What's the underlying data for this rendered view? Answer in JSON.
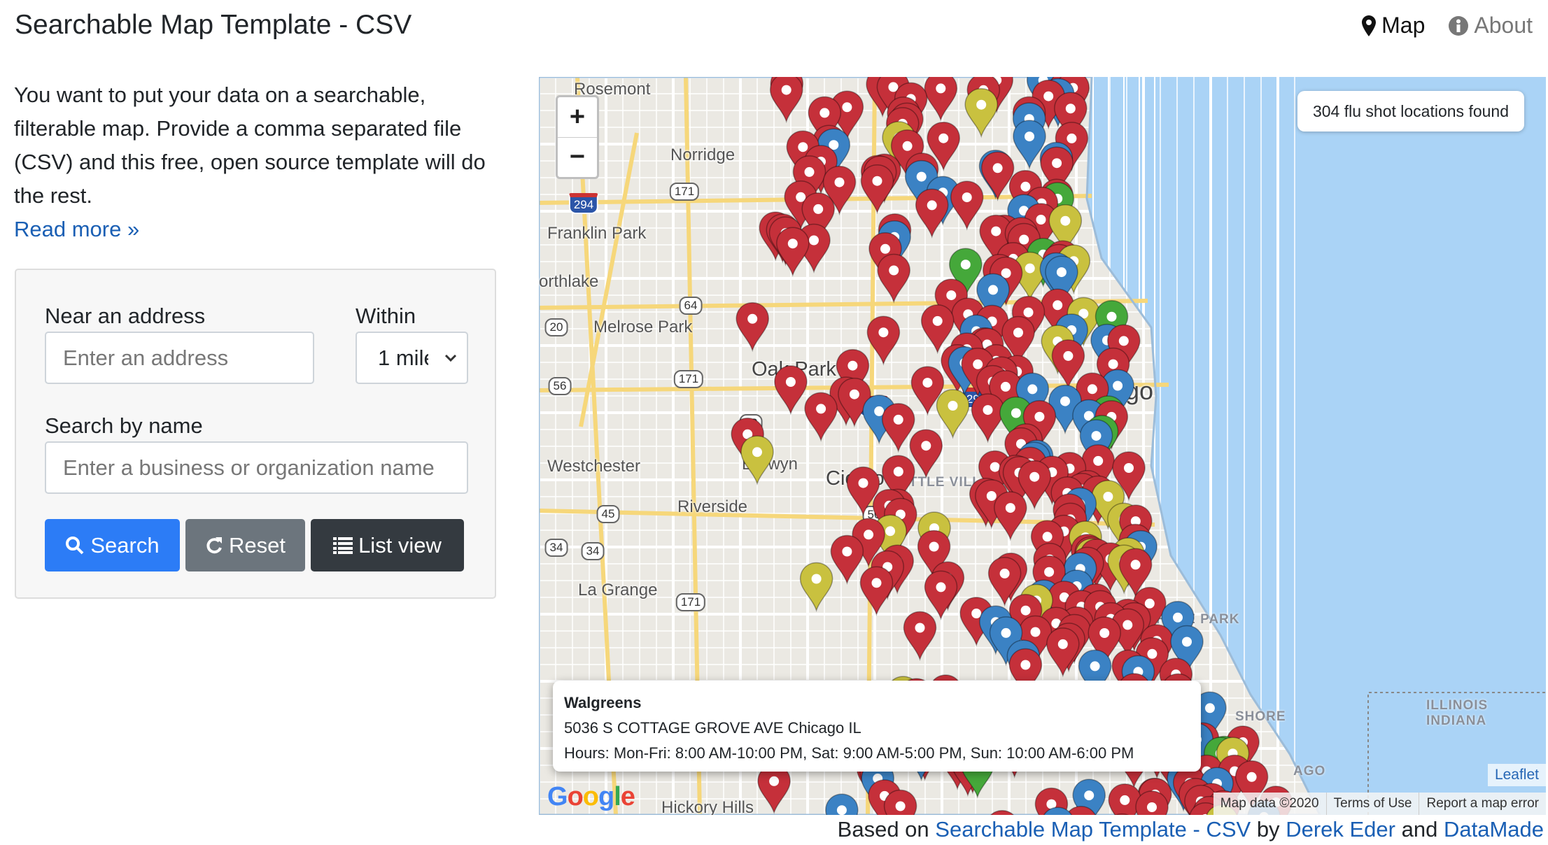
{
  "header": {
    "title": "Searchable Map Template - CSV",
    "nav": [
      {
        "label": "Map",
        "icon": "map-marker-icon"
      },
      {
        "label": "About",
        "icon": "info-circle-icon"
      }
    ]
  },
  "intro": {
    "text": "You want to put your data on a searchable, filterable map. Provide a comma separated file (CSV) and this free, open source template will do the rest.",
    "read_more": "Read more »"
  },
  "form": {
    "address_label": "Near an address",
    "address_placeholder": "Enter an address",
    "within_label": "Within",
    "within_value": "1 mile",
    "name_label": "Search by name",
    "name_placeholder": "Enter a business or organization name",
    "search_button": "Search",
    "reset_button": "Reset",
    "list_button": "List view"
  },
  "map": {
    "zoom_in": "+",
    "zoom_out": "−",
    "count_text": "304 flu shot locations found",
    "places": [
      "Rosemont",
      "Norridge",
      "Franklin Park",
      "orthlake",
      "Melrose Park",
      "Oak Park",
      "Westchester",
      "Berwyn",
      "Cicero",
      "Riverside",
      "La Grange",
      "Hickory Hills",
      "go"
    ],
    "districts": [
      "LITTLE VILL",
      "HYDE PARK",
      "SHORE",
      "AGO",
      "ILLINOIS",
      "INDIANA"
    ],
    "shields": [
      "294",
      "171",
      "64",
      "20",
      "171",
      "56",
      "43",
      "290",
      "290",
      "64",
      "45",
      "50",
      "34",
      "34",
      "171"
    ],
    "popup": {
      "name": "Walgreens",
      "address": "5036 S COTTAGE GROVE AVE Chicago IL",
      "hours": "Hours: Mon-Fri: 8:00 AM-10:00 PM, Sat: 9:00 AM-5:00 PM, Sun: 10:00 AM-6:00 PM"
    },
    "leaflet": "Leaflet",
    "attribution": [
      "Map data ©2020",
      "Terms of Use",
      "Report a map error"
    ],
    "google_logo": "Google",
    "marker_colors": {
      "red": "#c5303a",
      "blue": "#3b82c4",
      "yellow": "#c9c13f",
      "green": "#45a83a"
    },
    "land_color": "#ebe9e3",
    "water_color": "#aad3f6"
  },
  "footer": {
    "prefix": "Based on",
    "link1": "Searchable Map Template - CSV",
    "by": "by",
    "link2": "Derek Eder",
    "and": "and",
    "link3": "DataMade"
  },
  "colors": {
    "primary": "#2c7cf6",
    "secondary": "#6c757d",
    "dark": "#343a40",
    "link": "#1a5fb4"
  }
}
